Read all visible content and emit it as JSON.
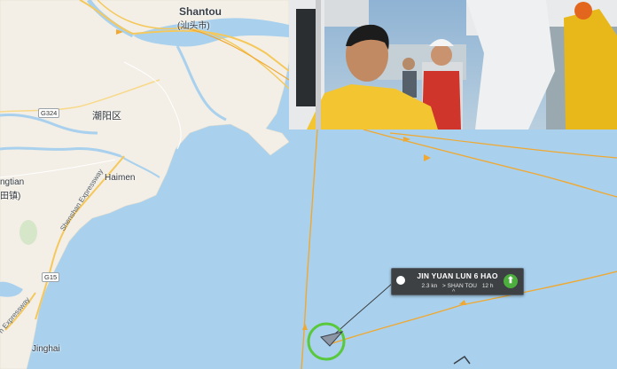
{
  "places": {
    "shantou": "Shantou",
    "shantou_cn": "(汕头市)",
    "chaoyang": "潮阳区",
    "haimen": "Haimen",
    "jinghai": "Jinghai",
    "ngtian": "ngtian",
    "ngtian_cn": "田镇)"
  },
  "roads": {
    "g324": "G324",
    "g15": "G15",
    "shenshan": "Shenshan Expressway",
    "expressway": "n Expressway"
  },
  "vessel": {
    "name": "JIN YUAN LUN 6 HAO",
    "speed": "2.3 kn",
    "destination": "> SHAN TOU",
    "age": "12 h"
  },
  "colors": {
    "sea": "#a9d1ee",
    "land": "#f3efe6",
    "track": "#f0a830",
    "highlight": "#5ac83c",
    "popup": "#3d4144"
  },
  "icons": {
    "ship": "ship-arrow-icon",
    "status": "status-dot-icon",
    "badge": "vessel-type-badge-icon"
  }
}
